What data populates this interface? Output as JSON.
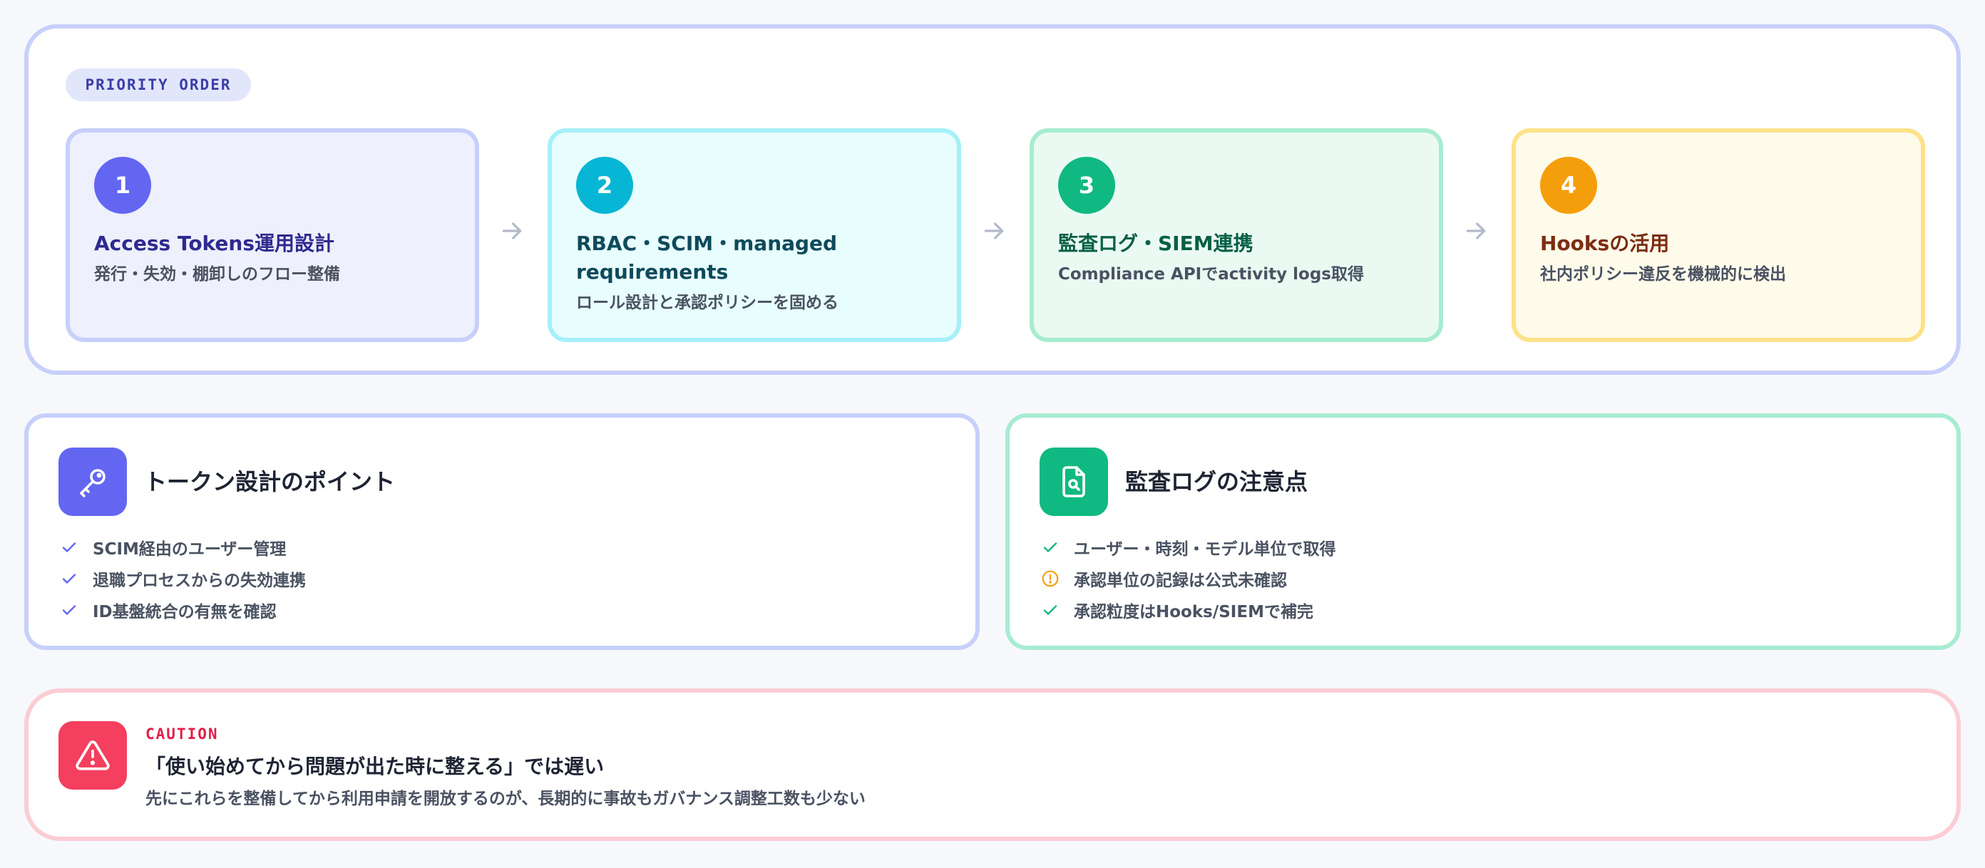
{
  "priority": {
    "label": "PRIORITY ORDER",
    "steps": [
      {
        "num": "1",
        "title": "Access Tokens運用設計",
        "desc": "発行・失効・棚卸しのフロー整備",
        "accent": "#6366f1",
        "bg": "#eef0fd",
        "border": "#c7d0fa",
        "title_color": "#2e2a8f"
      },
      {
        "num": "2",
        "title": "RBAC・SCIM・managed requirements",
        "desc": "ロール設計と承認ポリシーを固める",
        "accent": "#06b6d4",
        "bg": "#e8fdfd",
        "border": "#a5f0fa",
        "title_color": "#0e4a5c"
      },
      {
        "num": "3",
        "title": "監査ログ・SIEM連携",
        "desc": "Compliance APIでactivity logs取得",
        "accent": "#10b981",
        "bg": "#eafaf2",
        "border": "#a7ecd0",
        "title_color": "#065f46"
      },
      {
        "num": "4",
        "title": "Hooksの活用",
        "desc": "社内ポリシー違反を機械的に検出",
        "accent": "#f59e0b",
        "bg": "#fffbea",
        "border": "#fde28a",
        "title_color": "#7c2d12"
      }
    ],
    "arrow_icon": "arrow-right-icon"
  },
  "token_card": {
    "title": "トークン設計のポイント",
    "icon": "key-icon",
    "accent": "#6366f1",
    "items": [
      {
        "text": "SCIM経由のユーザー管理",
        "icon": "check-icon"
      },
      {
        "text": "退職プロセスからの失効連携",
        "icon": "check-icon"
      },
      {
        "text": "ID基盤統合の有無を確認",
        "icon": "check-icon"
      }
    ]
  },
  "audit_card": {
    "title": "監査ログの注意点",
    "icon": "file-search-icon",
    "accent": "#10b981",
    "items": [
      {
        "text": "ユーザー・時刻・モデル単位で取得",
        "icon": "check-icon"
      },
      {
        "text": "承認単位の記録は公式未確認",
        "icon": "alert-circle-icon"
      },
      {
        "text": "承認粒度はHooks/SIEMで補完",
        "icon": "check-icon"
      }
    ]
  },
  "caution": {
    "label": "CAUTION",
    "title": "「使い始めてから問題が出た時に整える」では遅い",
    "desc": "先にこれらを整備してから利用申請を開放するのが、長期的に事故もガバナンス調整工数も少ない",
    "icon": "warning-triangle-icon",
    "accent": "#f43f5e"
  }
}
